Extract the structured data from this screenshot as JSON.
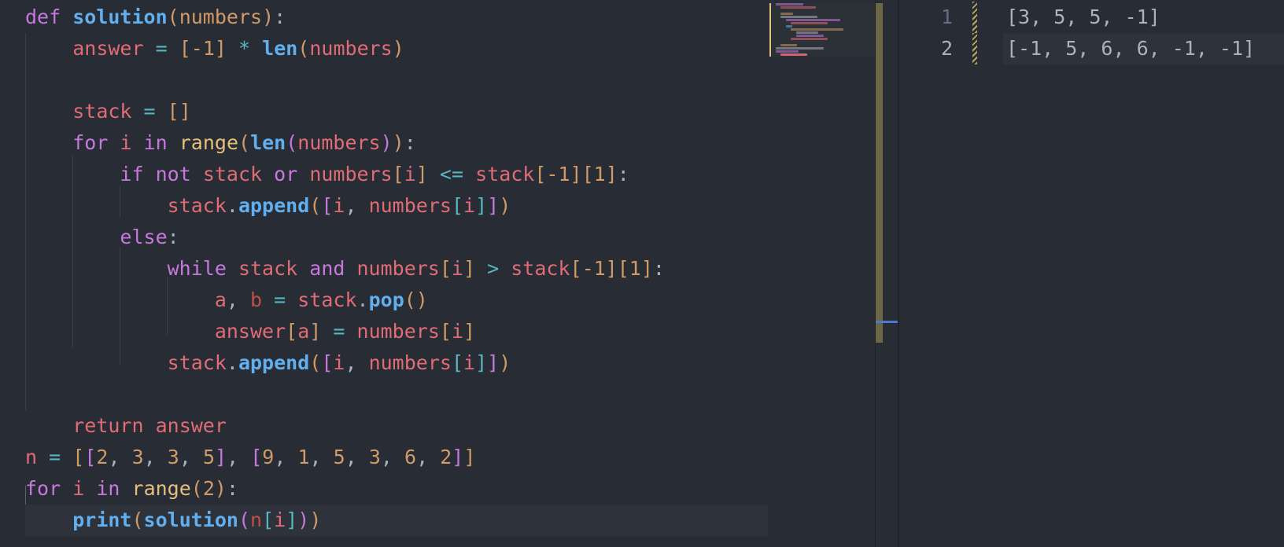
{
  "editor": {
    "language": "python",
    "code_lines": [
      "def solution(numbers):",
      "    answer = [-1] * len(numbers)",
      "",
      "    stack = []",
      "    for i in range(len(numbers)):",
      "        if not stack or numbers[i] <= stack[-1][1]:",
      "            stack.append([i, numbers[i]])",
      "        else:",
      "            while stack and numbers[i] > stack[-1][1]:",
      "                a, b = stack.pop()",
      "                answer[a] = numbers[i]",
      "            stack.append([i, numbers[i]])",
      "",
      "    return answer",
      "n = [[2, 3, 3, 5], [9, 1, 5, 3, 6, 2]]",
      "for i in range(2):",
      "    print(solution(n[i]))"
    ],
    "active_line": 17
  },
  "output": {
    "lines": [
      {
        "number": "1",
        "text": "[3, 5, 5, -1]"
      },
      {
        "number": "2",
        "text": "[-1, 5, 6, 6, -1, -1]"
      }
    ],
    "current_line": 2
  },
  "colors": {
    "background": "#282c34",
    "keyword": "#c678dd",
    "function": "#61afef",
    "variable": "#e06c75",
    "number": "#d19a66",
    "operator": "#56b6c2",
    "builtin": "#e5c07b",
    "scroll_thumb": "#6b6646",
    "scroll_marker": "#4d78cc"
  }
}
